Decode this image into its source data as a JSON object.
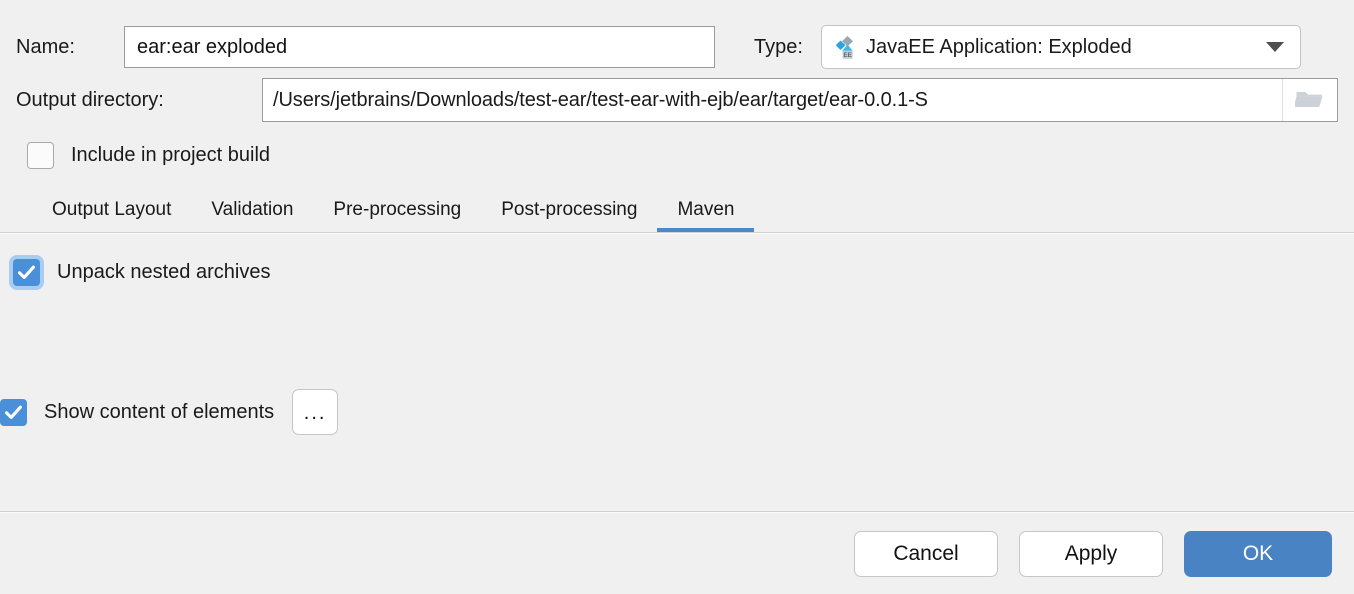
{
  "form": {
    "name_label": "Name:",
    "name_value": "ear:ear exploded",
    "type_label": "Type:",
    "type_value": "JavaEE Application: Exploded",
    "type_icon": "javaee-icon",
    "output_label": "Output directory:",
    "output_value": "/Users/jetbrains/Downloads/test-ear/test-ear-with-ejb/ear/target/ear-0.0.1-S",
    "browse_icon": "folder-icon",
    "include_in_build_label": "Include in project build",
    "include_in_build_checked": false
  },
  "tabs": [
    {
      "label": "Output Layout",
      "active": false
    },
    {
      "label": "Validation",
      "active": false
    },
    {
      "label": "Pre-processing",
      "active": false
    },
    {
      "label": "Post-processing",
      "active": false
    },
    {
      "label": "Maven",
      "active": true
    }
  ],
  "maven_panel": {
    "unpack_label": "Unpack nested archives",
    "unpack_checked": true,
    "show_content_label": "Show content of elements",
    "show_content_checked": true,
    "ellipsis_button_label": "..."
  },
  "footer": {
    "cancel_label": "Cancel",
    "apply_label": "Apply",
    "ok_label": "OK"
  },
  "colors": {
    "background": "#f0f0f0",
    "accent_blue": "#4a90d9",
    "tab_underline": "#4a88c7",
    "primary_button": "#4a83c4",
    "field_border": "#9b9b9b"
  }
}
